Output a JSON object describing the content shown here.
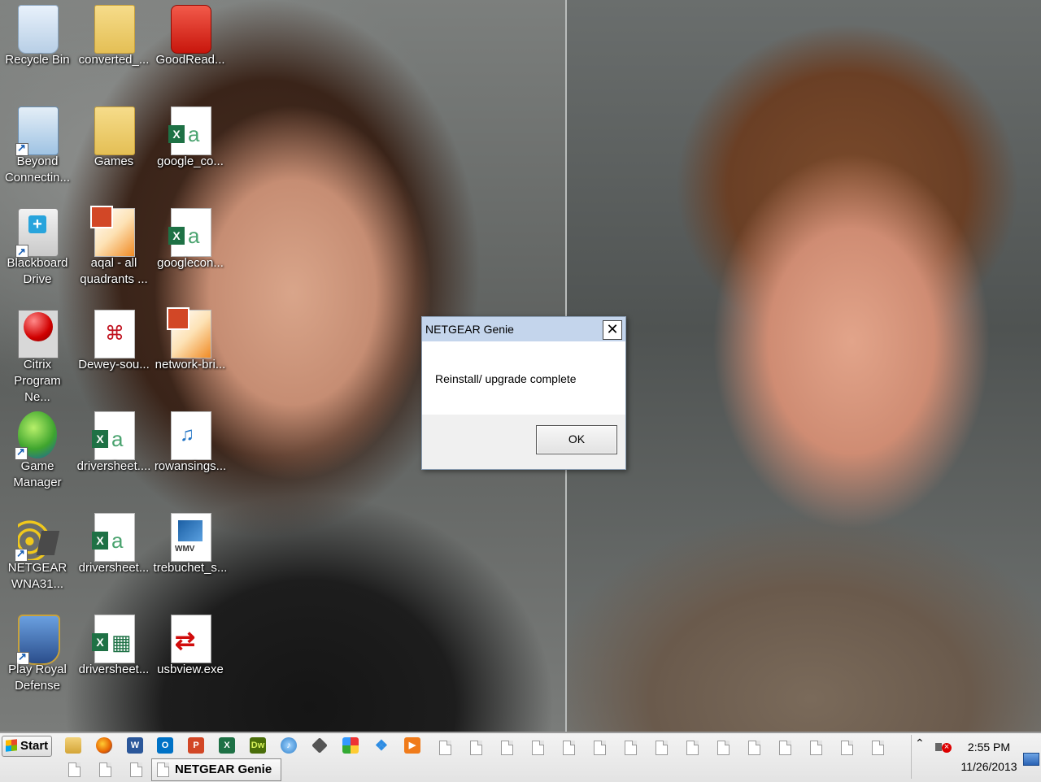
{
  "desktop": {
    "icons": [
      {
        "label": "Recycle Bin",
        "icon": "recycle-bin-icon"
      },
      {
        "label": "converted_...",
        "icon": "folder-icon"
      },
      {
        "label": "GoodRead...",
        "icon": "usb-app-icon"
      },
      {
        "label": "Beyond Connectin...",
        "icon": "beyond-connecting-icon"
      },
      {
        "label": "Games",
        "icon": "folder-icon"
      },
      {
        "label": "google_co...",
        "icon": "excel-file-icon"
      },
      {
        "label": "Blackboard Drive",
        "icon": "blackboard-drive-icon"
      },
      {
        "label": "aqal - all quadrants ...",
        "icon": "powerpoint-file-icon"
      },
      {
        "label": "googlecon...",
        "icon": "excel-file-icon"
      },
      {
        "label": "Citrix Program Ne...",
        "icon": "citrix-icon"
      },
      {
        "label": "Dewey-sou...",
        "icon": "pdf-file-icon"
      },
      {
        "label": "network-bri...",
        "icon": "powerpoint-file-icon"
      },
      {
        "label": "Game Manager",
        "icon": "game-manager-icon"
      },
      {
        "label": "driversheet....",
        "icon": "excel-file-icon"
      },
      {
        "label": "rowansings...",
        "icon": "audio-file-icon"
      },
      {
        "label": "NETGEAR WNA31...",
        "icon": "netgear-wifi-icon"
      },
      {
        "label": "driversheet...",
        "icon": "excel-file-icon"
      },
      {
        "label": "trebuchet_s...",
        "icon": "wmv-video-icon"
      },
      {
        "label": "Play Royal Defense",
        "icon": "royal-defense-icon"
      },
      {
        "label": "driversheet...",
        "icon": "excel-spreadsheet-icon"
      },
      {
        "label": "usbview.exe",
        "icon": "usbview-icon"
      }
    ]
  },
  "dialog": {
    "title": "NETGEAR Genie",
    "close_label": "✕",
    "message": "Reinstall/ upgrade complete",
    "ok_label": "OK"
  },
  "taskbar": {
    "start_label": "Start",
    "quick_launch": [
      "file-explorer-icon",
      "firefox-icon",
      "word-icon",
      "outlook-icon",
      "powerpoint-icon",
      "excel-icon",
      "dreamweaver-icon",
      "itunes-icon",
      "app-icon",
      "photos-icon",
      "dropbox-icon",
      "media-player-icon"
    ],
    "active_task": "NETGEAR Genie",
    "tray_arrow": "⌃",
    "time": "2:55 PM",
    "date": "11/26/2013"
  },
  "colors": {
    "dialog_title_bar": "#c4d5ec",
    "taskbar": "#e8e8e8",
    "excel_green": "#1e7145"
  }
}
